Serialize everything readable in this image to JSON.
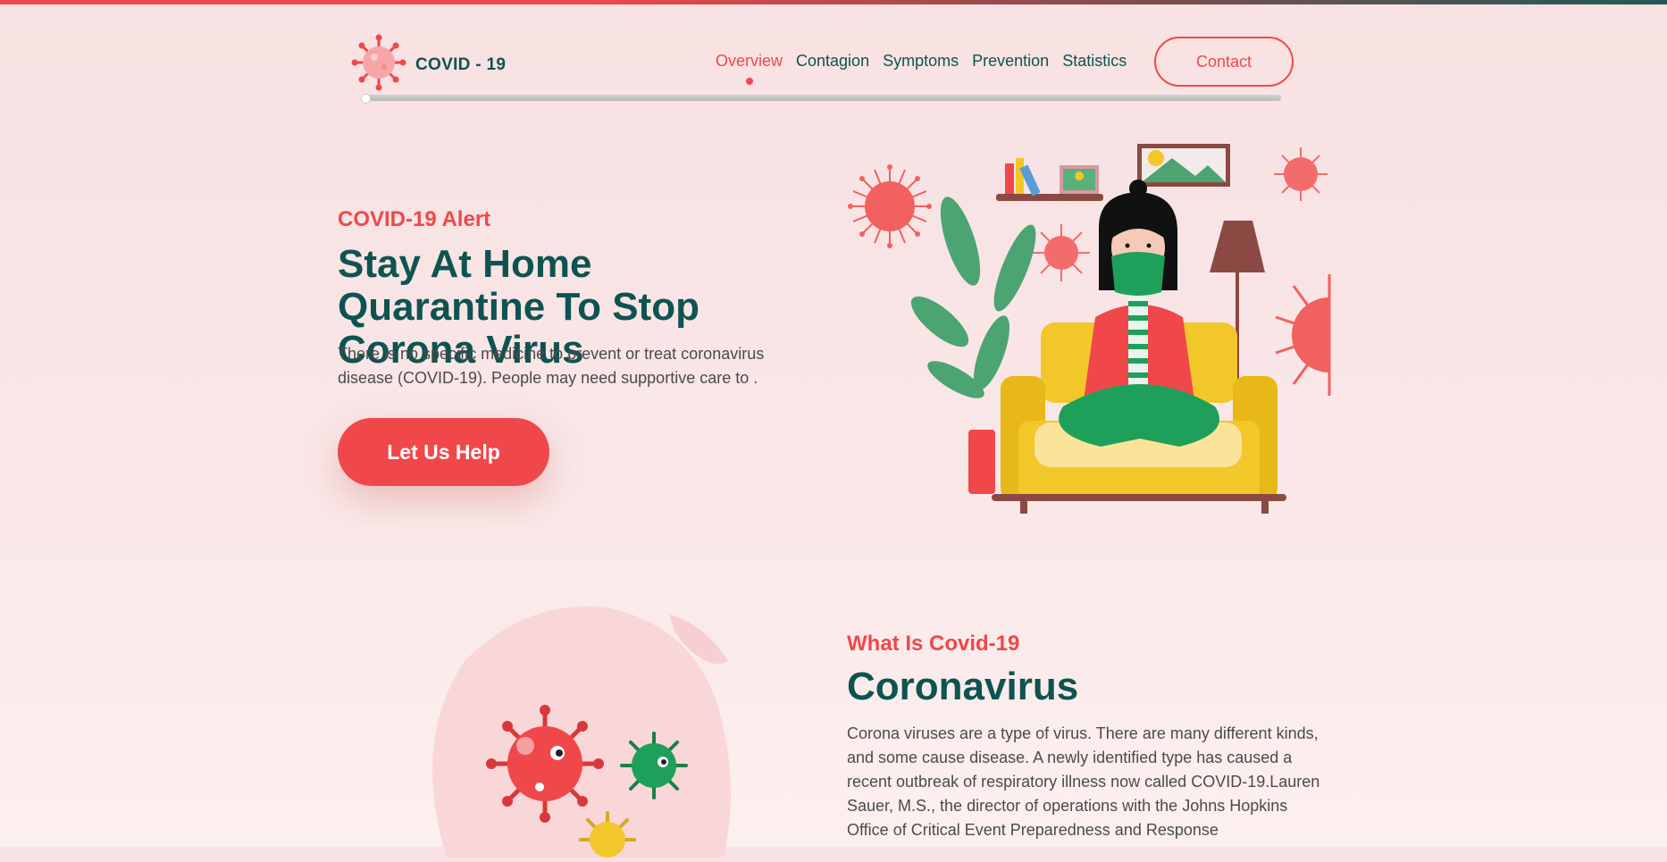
{
  "brand": {
    "name": "COVID - 19",
    "icon": "virus-icon"
  },
  "nav": {
    "items": [
      "Overview",
      "Contagion",
      "Symptoms",
      "Prevention",
      "Statistics"
    ],
    "active": "Overview",
    "contact_label": "Contact"
  },
  "hero": {
    "kicker": "COVID-19 Alert",
    "title": "Stay At Home Quarantine To Stop Corona Virus",
    "text": "There is no specific medicine to prevent or treat coronavirus disease (COVID-19). People may need supportive care to .",
    "cta_label": "Let Us Help",
    "illustration": "woman-in-mask-on-sofa-illustration"
  },
  "about": {
    "kicker": "What Is Covid-19",
    "title": "Coronavirus",
    "text": "Corona viruses are a type of virus. There are many different kinds, and some cause disease. A newly identified type has caused a recent outbreak of respiratory illness now called COVID-19.Lauren Sauer, M.S., the director of operations with the Johns Hopkins Office of Critical Event Preparedness and Response",
    "illustration": "virus-blob-illustration"
  },
  "colors": {
    "accent": "#f0484a",
    "primary": "#0d5451",
    "background": "#f8e1e2",
    "sofa": "#f2c72a",
    "green": "#1ea05a"
  }
}
